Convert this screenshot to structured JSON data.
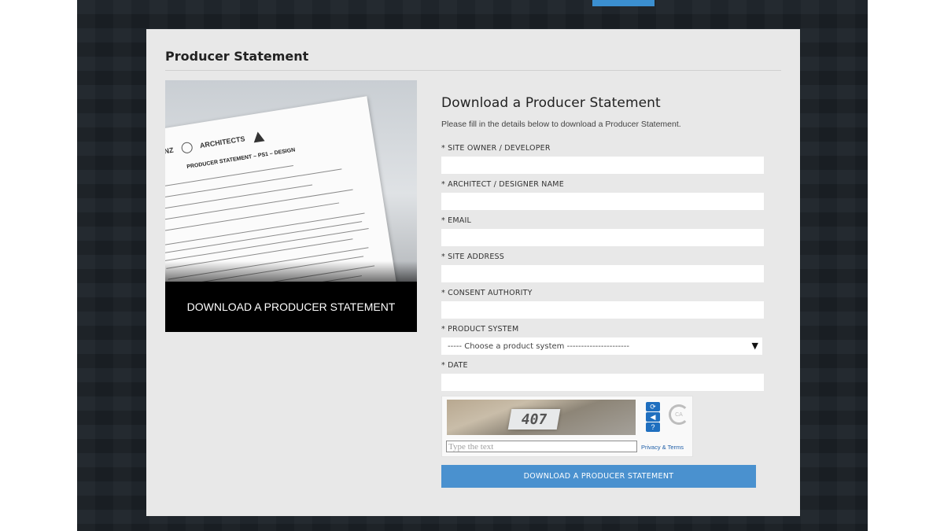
{
  "card": {
    "title": "Producer Statement"
  },
  "promo": {
    "banner_text": "DOWNLOAD A PRODUCER STATEMENT",
    "paper_logo_text": "IPENZ",
    "paper_partner_text": "ARCHITECTS",
    "paper_heading": "PRODUCER STATEMENT – PS1 – DESIGN"
  },
  "form": {
    "heading": "Download a Producer Statement",
    "intro": "Please fill in the details below to download a Producer Statement.",
    "fields": {
      "site_owner": {
        "label": "* SITE OWNER / DEVELOPER",
        "value": ""
      },
      "architect": {
        "label": "* ARCHITECT / DESIGNER NAME",
        "value": ""
      },
      "email": {
        "label": "* EMAIL",
        "value": ""
      },
      "site_address": {
        "label": "* SITE ADDRESS",
        "value": ""
      },
      "consent_authority": {
        "label": "* CONSENT AUTHORITY",
        "value": ""
      },
      "product_system": {
        "label": "* PRODUCT SYSTEM",
        "selected": "----- Choose a product system ----------------------"
      },
      "date": {
        "label": "* DATE",
        "value": ""
      }
    },
    "captcha": {
      "image_text": "407",
      "placeholder": "Type the text",
      "links": "Privacy & Terms",
      "logo_text": "CA"
    },
    "submit_label": "DOWNLOAD A PRODUCER STATEMENT"
  },
  "colors": {
    "accent": "#4a91cf",
    "background": "#1f252b",
    "card": "#e8e8e8"
  }
}
